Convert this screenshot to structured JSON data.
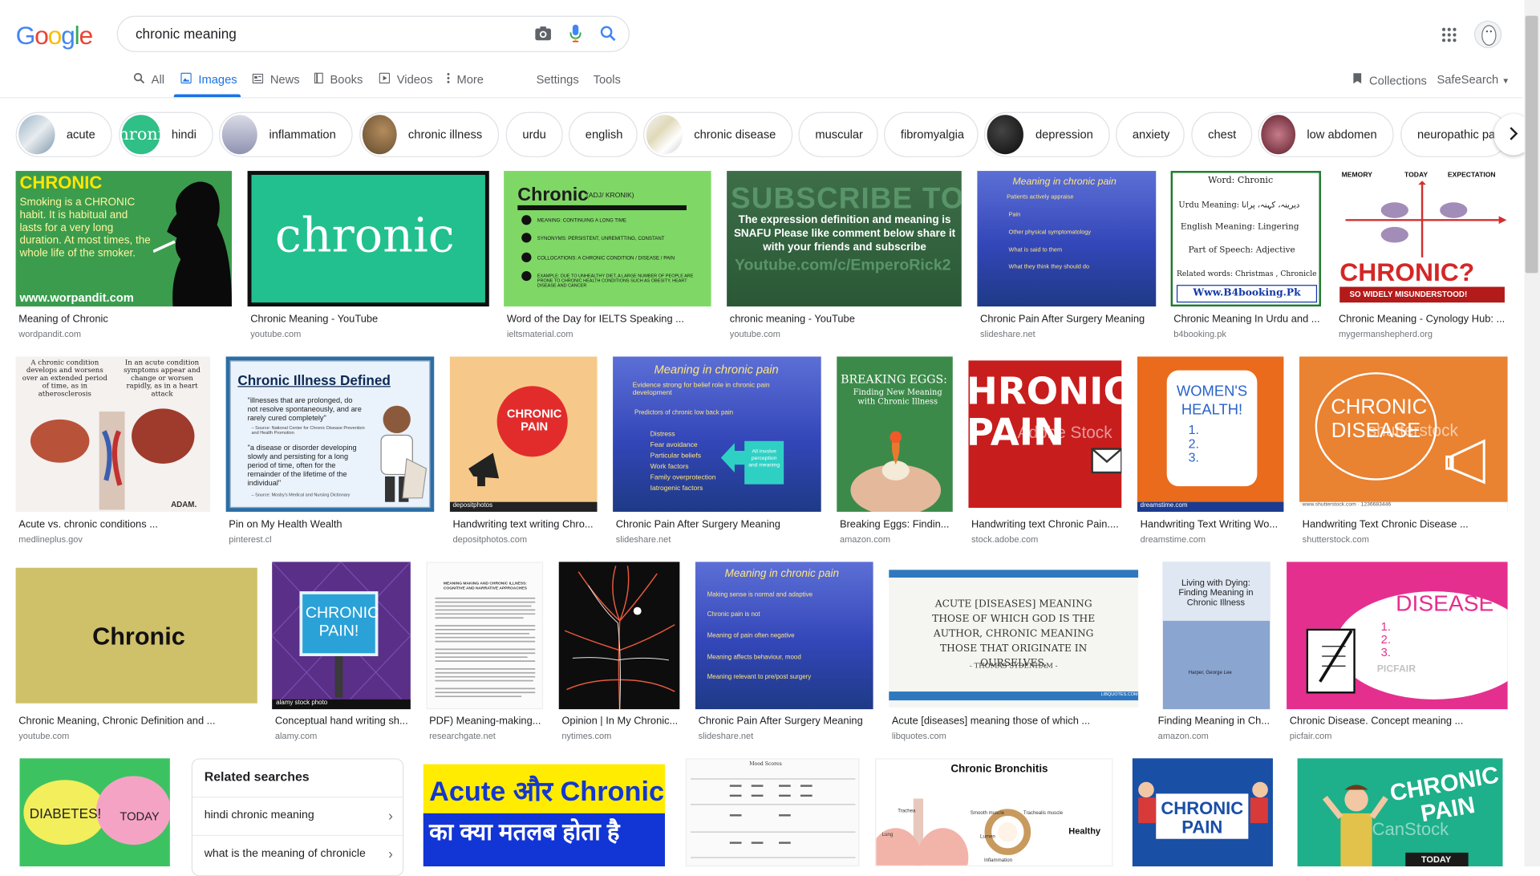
{
  "logo": {
    "letters": [
      "G",
      "o",
      "o",
      "g",
      "l",
      "e"
    ],
    "colors": [
      "#4285F4",
      "#EA4335",
      "#FBBC05",
      "#4285F4",
      "#34A853",
      "#EA4335"
    ]
  },
  "search": {
    "value": "chronic meaning"
  },
  "tabs": [
    {
      "icon": "search-icon",
      "label": "All"
    },
    {
      "icon": "images-icon",
      "label": "Images"
    },
    {
      "icon": "news-icon",
      "label": "News"
    },
    {
      "icon": "books-icon",
      "label": "Books"
    },
    {
      "icon": "videos-icon",
      "label": "Videos"
    },
    {
      "icon": "more-icon",
      "label": "More"
    },
    {
      "label": "Settings"
    },
    {
      "label": "Tools"
    }
  ],
  "header_right": {
    "collections": "Collections",
    "safesearch": "SafeSearch"
  },
  "chips": [
    "acute",
    "hindi",
    "inflammation",
    "chronic illness",
    "urdu",
    "english",
    "chronic disease",
    "muscular",
    "fibromyalgia",
    "depression",
    "anxiety",
    "chest",
    "low abdomen",
    "neuropathic pai"
  ],
  "chip_thumb_texts": {
    "hindi": "hroni"
  },
  "results_row1": [
    {
      "caption": "Meaning of Chronic",
      "source": "wordpandit.com"
    },
    {
      "caption": "Chronic Meaning - YouTube",
      "source": "youtube.com"
    },
    {
      "caption": "Word of the Day for IELTS Speaking ...",
      "source": "ieltsmaterial.com"
    },
    {
      "caption": "chronic meaning - YouTube",
      "source": "youtube.com"
    },
    {
      "caption": "Chronic Pain After Surgery Meaning",
      "source": "slideshare.net"
    },
    {
      "caption": "Chronic Meaning In Urdu and ...",
      "source": "b4booking.pk"
    },
    {
      "caption": "Chronic Meaning - Cynology Hub: ...",
      "source": "mygermanshepherd.org"
    }
  ],
  "results_row2": [
    {
      "caption": "Acute vs. chronic conditions ...",
      "source": "medlineplus.gov"
    },
    {
      "caption": "Pin on My Health Wealth",
      "source": "pinterest.cl"
    },
    {
      "caption": "Handwriting text writing Chro...",
      "source": "depositphotos.com"
    },
    {
      "caption": "Chronic Pain After Surgery Meaning",
      "source": "slideshare.net"
    },
    {
      "caption": "Breaking Eggs: Findin...",
      "source": "amazon.com"
    },
    {
      "caption": "Handwriting text Chronic Pain....",
      "source": "stock.adobe.com"
    },
    {
      "caption": "Handwriting Text Writing Wo...",
      "source": "dreamstime.com"
    },
    {
      "caption": "Handwriting Text Chronic Disease ...",
      "source": "shutterstock.com"
    }
  ],
  "results_row3": [
    {
      "caption": "Chronic Meaning, Chronic Definition and ...",
      "source": "youtube.com"
    },
    {
      "caption": "Conceptual hand writing sh...",
      "source": "alamy.com"
    },
    {
      "caption": "PDF) Meaning-making...",
      "source": "researchgate.net"
    },
    {
      "caption": "Opinion | In My Chronic...",
      "source": "nytimes.com"
    },
    {
      "caption": "Chronic Pain After Surgery Meaning",
      "source": "slideshare.net"
    },
    {
      "caption": "Acute [diseases] meaning those of which ...",
      "source": "libquotes.com"
    },
    {
      "caption": "Finding Meaning in Ch...",
      "source": "amazon.com"
    },
    {
      "caption": "Chronic Disease. Concept meaning ...",
      "source": "picfair.com"
    }
  ],
  "thumb_texts": {
    "wordpandit_title": "CHRONIC",
    "wordpandit_body": "Smoking is a CHRONIC habit. It is habitual and lasts for a very long duration. At most times, the whole life of the smoker.",
    "wordpandit_url": "www.worpandit.com",
    "yt_chronic": "chronic",
    "ielts_title": "Chronic",
    "ielts_phon": "(ADJ/ KRONIK)",
    "ielts_items": [
      "MEANING: CONTINUING A LONG TIME",
      "SYNONYMS: PERSISTENT, UNREMITTING, CONSTANT",
      "COLLOCATIONS: A CHRONIC CONDITION / DISEASE / PAIN",
      "EXAMPLE: DUE TO UNHEALTHY DIET, A LARGE NUMBER OF PEOPLE ARE PRONE TO CHRONIC HEALTH CONDITIONS SUCH AS OBESITY, HEART DISEASE AND CANCER"
    ],
    "subscribe_big": "SUBSCRIBE TO",
    "subscribe_body": "The expression definition and meaning is SNAFU Please like comment below share it with your friends and subscribe",
    "subscribe_url": "Youtube.com/c/EmperoRick2",
    "slideshare_title": "Meaning in chronic pain",
    "slideshare_items": [
      "Patients actively appraise",
      "Pain",
      "Other physical symptomatology",
      "What is said to them",
      "What they think they should do"
    ],
    "urdu_word": "Word: Chronic",
    "urdu_meaning": "Urdu Meaning: دیرینہ، کہنہ، پرانا",
    "urdu_eng": "English Meaning: Lingering",
    "urdu_pos": "Part of Speech: Adjective",
    "urdu_related": "Related words: Christmas , Chronicle",
    "urdu_url": "Www.B4booking.Pk",
    "cyn_memory": "MEMORY",
    "cyn_today": "TODAY",
    "cyn_expect": "EXPECTATION",
    "cyn_big": "CHRONIC?",
    "cyn_sub": "SO WIDELY MISUNDERSTOOD!",
    "medline_left": "A chronic condition develops and worsens over an extended period of time, as in atherosclerosis",
    "medline_right": "In an acute condition symptoms appear and change or worsen rapidly, as in a heart attack",
    "medline_adam": "ADAM.",
    "pin_title": "Chronic Illness Defined",
    "pin_q1": "\"illnesses that are prolonged, do not resolve spontaneously, and are rarely cured completely\"",
    "pin_s1": "– Source: National Center for Chronic Disease Prevention and Health Promotion",
    "pin_q2": "\"a disease or disorder developing slowly and persisting for a long period of time, often for the remainder of the lifetime of the individual\"",
    "pin_s2": "– Source: Mosby's Medical and Nursing Dictionary",
    "dep_text": "CHRONIC PAIN",
    "dep_logo": "depositphotos",
    "ss2_title": "Meaning in chronic pain",
    "ss2_items": [
      "Evidence strong for belief role in chronic pain development",
      "Predictors of chronic low back pain",
      "Distress",
      "Fear avoidance",
      "Particular beliefs",
      "Work factors",
      "Family overprotection",
      "Iatrogenic factors"
    ],
    "ss2_box": "All involve perception and meaning",
    "eggs_title": "BREAKING EGGS:",
    "eggs_sub": "Finding New Meaning with Chronic Illness",
    "adobe_text": "HRONIC PAIN",
    "adobe_wm": "Adobe Stock",
    "dream_text": "WOMEN'S HEALTH!",
    "dream_list": "1. 2. 3.",
    "dream_logo": "dreamstime.com",
    "shutter_text": "CHRONIC DISEASE",
    "shutter_wm": "shutterstock",
    "shutter_id": "www.shutterstock.com · 1236683446",
    "ytchronic2": "Chronic",
    "alamy_text": "CHRONIC PAIN!",
    "alamy_logo": "alamy stock photo",
    "rg_title": "MEANING MAKING AND CHRONIC ILLNESS: COGNITIVE AND NARRATIVE APPROACHES",
    "ss3_title": "Meaning in chronic pain",
    "ss3_items": [
      "Making sense is normal and adaptive",
      "Chronic pain is not",
      "Meaning of pain often negative",
      "Meaning affects behaviour, mood",
      "Meaning relevant to pre/post surgery"
    ],
    "lib_quote": "ACUTE [DISEASES] MEANING THOSE OF WHICH GOD IS THE AUTHOR, CHRONIC MEANING THOSE THAT ORIGINATE IN OURSELVES.",
    "lib_author": "- THOMAS SYDENHAM -",
    "lib_logo": "LIBQUOTES.COM",
    "amz_title": "Living with Dying: Finding Meaning in Chronic Illness",
    "amz_author": "Harper, George Lee",
    "picfair_text": "CHRONIC DISEASE",
    "picfair_list": "1. 2. 3.",
    "picfair_wm": "PICFAIR",
    "diab_text1": "DIABETES!",
    "diab_text2": "TODAY",
    "acute_hindi_1": "Acute और Chronic",
    "acute_hindi_2": "का क्या मतलब होता है",
    "mood_title": "Mood Scores",
    "bronch_title": "Chronic Bronchitis",
    "bronch_labels": [
      "Trachea",
      "Smooth muscle",
      "Trachealis muscle",
      "Lung",
      "Lumen",
      "Healthy",
      "Inflammation"
    ],
    "cp1_text": "CHRONIC PAIN",
    "cp2_text": "CHRONIC PAIN",
    "cp2_today": "TODAY",
    "canstock_wm": "CanStock"
  },
  "related": {
    "title": "Related searches",
    "items": [
      "hindi chronic meaning",
      "what is the meaning of chronicle"
    ]
  }
}
